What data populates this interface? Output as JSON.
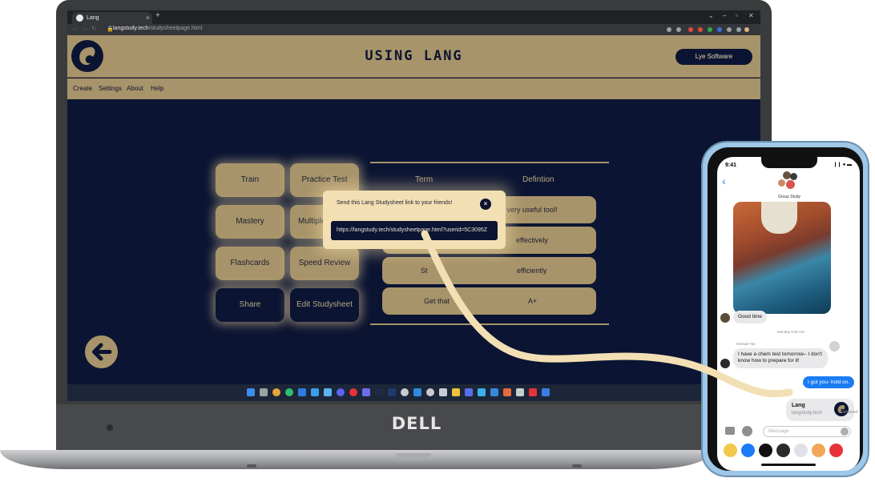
{
  "browser": {
    "tab_title": "Lang",
    "tab_close": "×",
    "new_tab": "+",
    "url_host": "langstudy.tech",
    "url_path": "/studysheetpage.html"
  },
  "header": {
    "title": "USING LANG",
    "company_button": "Lye Software"
  },
  "menu": [
    "Create",
    "Settings",
    "About",
    "Help"
  ],
  "modes": {
    "train": "Train",
    "practice_test": "Practice Test",
    "mastery": "Mastery",
    "multiple_choice": "Multiple",
    "flashcards": "Flashcards",
    "speed_review": "Speed Review",
    "share": "Share",
    "edit": "Edit Studysheet"
  },
  "terms_table": {
    "headers": [
      "Term",
      "Defintion"
    ],
    "rows": [
      {
        "term": "",
        "definition": "a very useful tool!"
      },
      {
        "term": "",
        "definition": "effectively"
      },
      {
        "term": "St",
        "definition": "efficiently"
      },
      {
        "term": "Get that",
        "definition": "A+"
      }
    ]
  },
  "share_dialog": {
    "message": "Send this Lang Studysheet link to your friends!",
    "link": "https://langstudy.tech/studysheetpage.html?userid=5C3095Z",
    "close": "×"
  },
  "laptop_brand": "DELL",
  "phone": {
    "time": "9:41",
    "status_icons": "❙❙ ● ▬",
    "back": "‹",
    "group_name": "Group Study",
    "messages": {
      "photo_reply": "Good time",
      "timestamp": "Monday 9:30 AM",
      "sender": "Michael Tan",
      "chem_message": "I have a chem test tomorrow– I don't know how to prepare for it!",
      "reply": "I got you- hold on.",
      "link_title": "Lang",
      "link_domain": "langstudy.tech",
      "delivered": "Delivered"
    },
    "compose_placeholder": "iMessage"
  },
  "colors": {
    "gold": "#a8946a",
    "navy": "#0b1432",
    "cream": "#f2dfb3",
    "imessage_blue": "#1a7cf5"
  }
}
